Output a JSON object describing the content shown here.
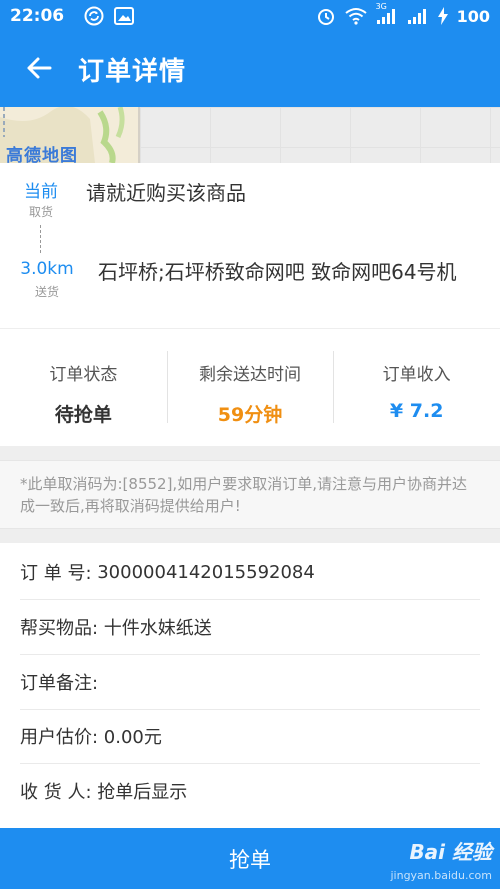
{
  "status_bar": {
    "time": "22:06",
    "signal_1": "3G",
    "battery": "100"
  },
  "header": {
    "title": "订单详情"
  },
  "map": {
    "logo_text": "高德地图"
  },
  "address": {
    "pickup_distance": "当前",
    "pickup_label": "取货",
    "pickup_text": "请就近购买该商品",
    "delivery_distance": "3.0km",
    "delivery_label": "送货",
    "delivery_text": "石坪桥;石坪桥致命网吧 致命网吧64号机"
  },
  "stats": {
    "status_label": "订单状态",
    "status_value": "待抢单",
    "time_label": "剩余送达时间",
    "time_value": "59分钟",
    "income_label": "订单收入",
    "income_value": "¥ 7.2"
  },
  "notice": {
    "text": "*此单取消码为:[8552],如用户要求取消订单,请注意与用户协商并达成一致后,再将取消码提供给用户!"
  },
  "details": {
    "order_no_key": "订 单 号: ",
    "order_no_value": "3000004142015592084",
    "item_key": "帮买物品: ",
    "item_value": "十件水妹纸送",
    "remark_key": "订单备注: ",
    "remark_value": "",
    "price_key": "用户估价: ",
    "price_value": "0.00元",
    "receiver_key": "收 货 人: ",
    "receiver_value": "抢单后显示"
  },
  "actions": {
    "grab_label": "抢单"
  },
  "watermark": {
    "logo": "Bai 经验",
    "url": "jingyan.baidu.com"
  },
  "colors": {
    "brand_blue": "#1e8df0",
    "orange": "#f08f12"
  }
}
